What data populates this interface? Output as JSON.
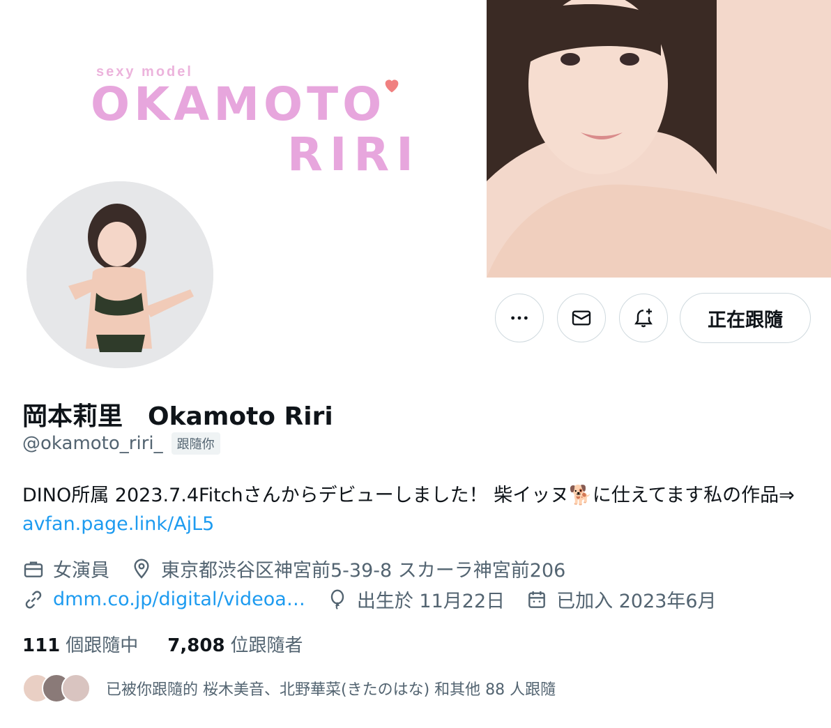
{
  "banner": {
    "tagline": "sexy model",
    "logo_line1": "OKAMOTO",
    "logo_line2": "RIRI",
    "accent_color": "#e7a6dd"
  },
  "actions": {
    "more_icon": "more-horizontal-icon",
    "message_icon": "envelope-icon",
    "notify_icon": "bell-plus-icon",
    "follow_label": "正在跟隨"
  },
  "profile": {
    "display_name": "岡本莉里　Okamoto Riri",
    "handle": "@okamoto_riri_",
    "follows_you": "跟隨你",
    "bio_text": "DINO所属 2023.7.4Fitchさんからデビューしました！ 柴イッヌ🐕に仕えてます私の作品⇒ ",
    "bio_link": "avfan.page.link/AjL5",
    "category": "女演員",
    "location": "東京都渋谷区神宮前5-39-8 スカーラ神宮前206",
    "website": "dmm.co.jp/digital/videoa…",
    "birthday": "出生於 11月22日",
    "joined": "已加入 2023年6月"
  },
  "stats": {
    "following_count": "111",
    "following_label": "個跟隨中",
    "followers_count": "7,808",
    "followers_label": "位跟隨者"
  },
  "followed_by": {
    "text": "已被你跟隨的 桜木美音、北野華菜(きたのはな) 和其他 88 人跟隨"
  }
}
